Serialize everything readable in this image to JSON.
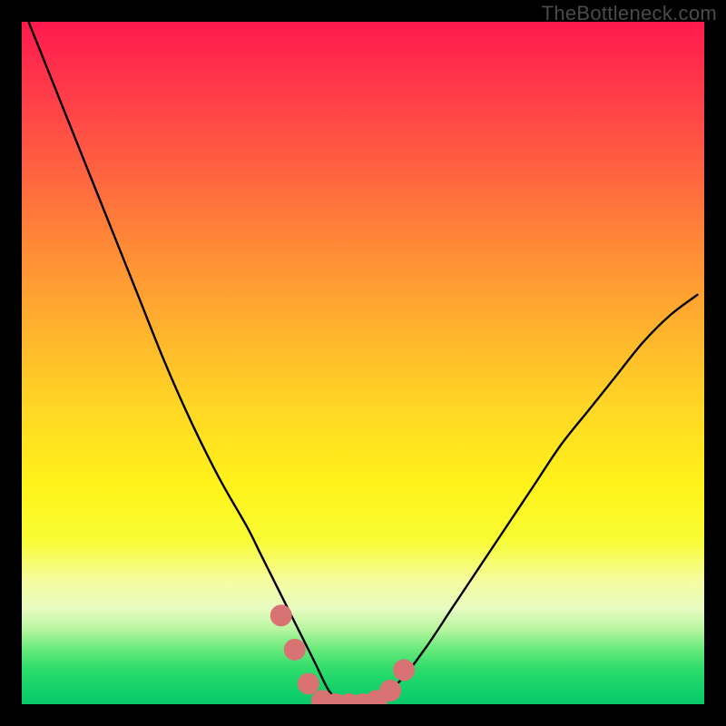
{
  "watermark": {
    "text": "TheBottleneck.com"
  },
  "colors": {
    "frame": "#000000",
    "curve_stroke": "#000000",
    "marker_fill": "#d97373",
    "gradient_stops": [
      "#ff1a4d",
      "#ff3a4a",
      "#ff6340",
      "#ff8a36",
      "#ffb22e",
      "#ffd824",
      "#fff31a",
      "#f8fc35",
      "#f6fca0",
      "#e8fbc1",
      "#b8f6a0",
      "#66e97a",
      "#2bdc6b",
      "#12d06a",
      "#0bc968"
    ]
  },
  "chart_data": {
    "type": "line",
    "title": "",
    "xlabel": "",
    "ylabel": "",
    "xlim": [
      0,
      100
    ],
    "ylim": [
      0,
      100
    ],
    "grid": false,
    "legend": false,
    "series": [
      {
        "name": "bottleneck-curve",
        "x": [
          1,
          5,
          9,
          13,
          17,
          21,
          25,
          29,
          33,
          35,
          37,
          39,
          41,
          43,
          45,
          47,
          49,
          51,
          55,
          59,
          63,
          67,
          71,
          75,
          79,
          83,
          87,
          91,
          95,
          99
        ],
        "y": [
          100,
          90,
          80,
          70,
          60,
          50,
          41,
          33,
          26,
          22,
          18,
          14,
          10,
          6,
          2,
          0,
          0,
          0.5,
          3,
          8,
          14,
          20,
          26,
          32,
          38,
          43,
          48,
          53,
          57,
          60
        ]
      }
    ],
    "markers": {
      "name": "valley-markers",
      "x": [
        38,
        40,
        42,
        44,
        46,
        48,
        50,
        52,
        54,
        56
      ],
      "y": [
        13,
        8,
        3,
        0.5,
        0,
        0,
        0,
        0.5,
        2,
        5
      ]
    }
  }
}
